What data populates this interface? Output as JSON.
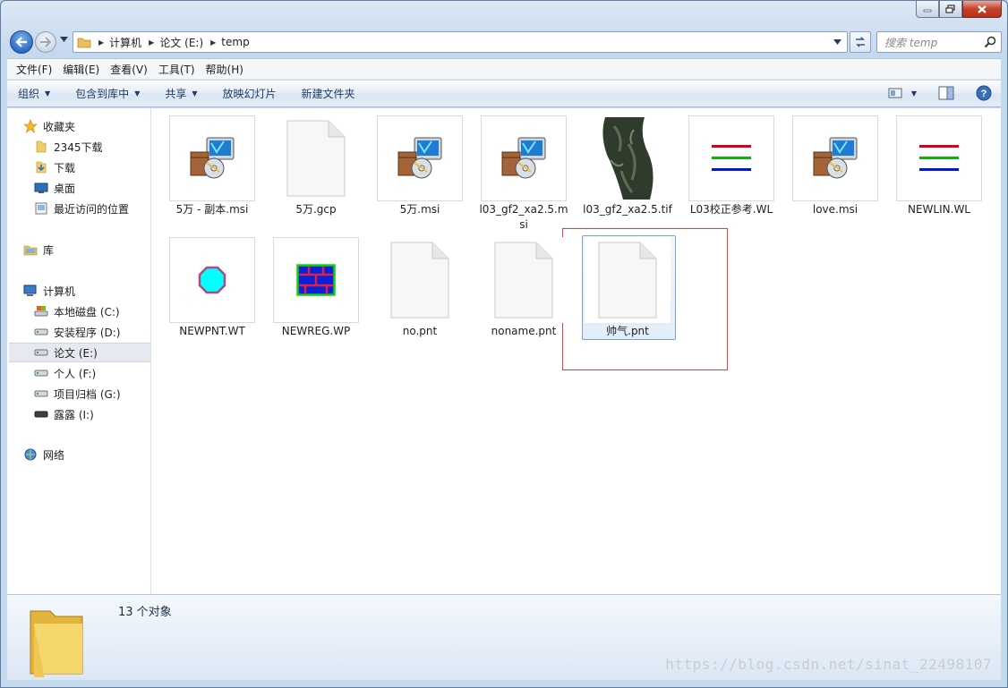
{
  "titlebar": {
    "buttons": [
      "minimize",
      "maximize",
      "close"
    ]
  },
  "address": {
    "crumbs": [
      "计算机",
      "论文 (E:)",
      "temp"
    ],
    "search_placeholder": "搜索 temp"
  },
  "menu": [
    "文件(F)",
    "编辑(E)",
    "查看(V)",
    "工具(T)",
    "帮助(H)"
  ],
  "commands": [
    "组织",
    "包含到库中",
    "共享",
    "放映幻灯片",
    "新建文件夹"
  ],
  "sidebar": {
    "favorites": {
      "label": "收藏夹",
      "items": [
        "2345下载",
        "下载",
        "桌面",
        "最近访问的位置"
      ]
    },
    "library": "库",
    "computer": {
      "label": "计算机",
      "items": [
        "本地磁盘 (C:)",
        "安装程序 (D:)",
        "论文 (E:)",
        "个人 (F:)",
        "项目归档 (G:)",
        "露露 (I:)"
      ]
    },
    "network": "网络"
  },
  "files": [
    {
      "name": "5万 - 副本.msi",
      "kind": "msi"
    },
    {
      "name": "5万.gcp",
      "kind": "blank"
    },
    {
      "name": "5万.msi",
      "kind": "msi"
    },
    {
      "name": "l03_gf2_xa2.5.msi",
      "kind": "msi"
    },
    {
      "name": "l03_gf2_xa2.5.tif",
      "kind": "tif"
    },
    {
      "name": "L03校正参考.WL",
      "kind": "lines"
    },
    {
      "name": "love.msi",
      "kind": "msi"
    },
    {
      "name": "NEWLIN.WL",
      "kind": "lines"
    },
    {
      "name": "NEWPNT.WT",
      "kind": "point"
    },
    {
      "name": "NEWREG.WP",
      "kind": "region"
    },
    {
      "name": "no.pnt",
      "kind": "blank"
    },
    {
      "name": "noname.pnt",
      "kind": "blank"
    },
    {
      "name": "帅气.pnt",
      "kind": "blank"
    }
  ],
  "status": {
    "count_text": "13 个对象"
  },
  "watermark": "https://blog.csdn.net/sinat_22498107",
  "colors": {
    "accent": "#3a6fb5",
    "highlight_box": "#d9444a"
  }
}
